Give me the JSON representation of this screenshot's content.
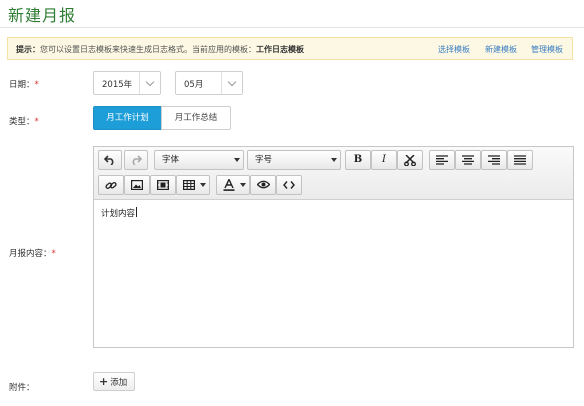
{
  "title": "新建月报",
  "tip": {
    "prefix": "提示：",
    "message": "您可以设置日志模板来快速生成日志格式。当前应用的模板：",
    "template_name": "工作日志模板",
    "links": [
      "选择模板",
      "新建模板",
      "管理模板"
    ]
  },
  "form": {
    "date_label": "日期：",
    "type_label": "类型：",
    "content_label": "月报内容：",
    "attach_label": "附件：",
    "required_mark": "*"
  },
  "date": {
    "year": "2015年",
    "month": "05月"
  },
  "type_tabs": [
    "月工作计划",
    "月工作总结"
  ],
  "selected_tab": "月工作计划",
  "editor": {
    "font_family_label": "字体",
    "font_size_label": "字号",
    "bold": "B",
    "italic": "I",
    "content": "计划内容"
  },
  "attach_button": "添加",
  "colors": {
    "title_green": "#2e7d32",
    "tab_active": "#1e9ed8",
    "link_blue": "#3a7ec2",
    "required_red": "#d9302c",
    "tip_bg": "#fcf8e3"
  }
}
